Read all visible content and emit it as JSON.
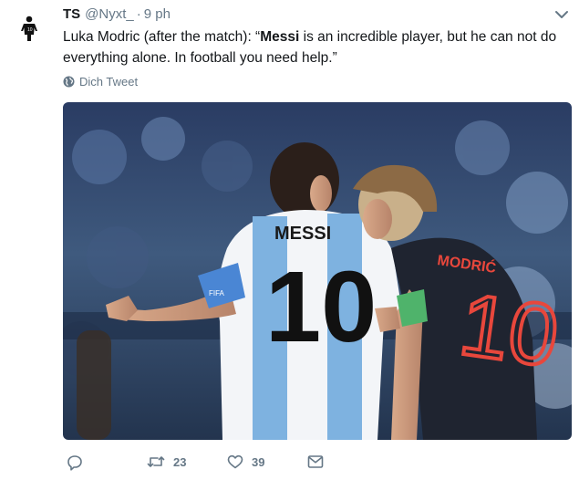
{
  "tweet": {
    "display_name": "TS",
    "handle": "@Nyxt_",
    "separator": "·",
    "time": "9 ph",
    "text_before": "Luka Modric (after the match): “",
    "text_bold": "Messi",
    "text_after": " is an incredible player, but he can not do everything alone. In football you need help.”",
    "translate_label": "Dich Tweet",
    "photo": {
      "back_name_left": "MESSI",
      "back_number_left": "10",
      "back_name_right": "MODRIĆ",
      "back_number_right": "10",
      "armband_text": "FIFA"
    },
    "actions": {
      "retweets": "23",
      "likes": "39"
    }
  },
  "colors": {
    "text": "#14171a",
    "muted": "#657786",
    "argentina_blue": "#75aadb",
    "croatia_shirt": "#1f2430",
    "croatia_number": "#e8473c"
  },
  "icons": [
    "reply-icon",
    "retweet-icon",
    "like-icon",
    "dm-icon",
    "globe-icon",
    "caret-down-icon"
  ]
}
